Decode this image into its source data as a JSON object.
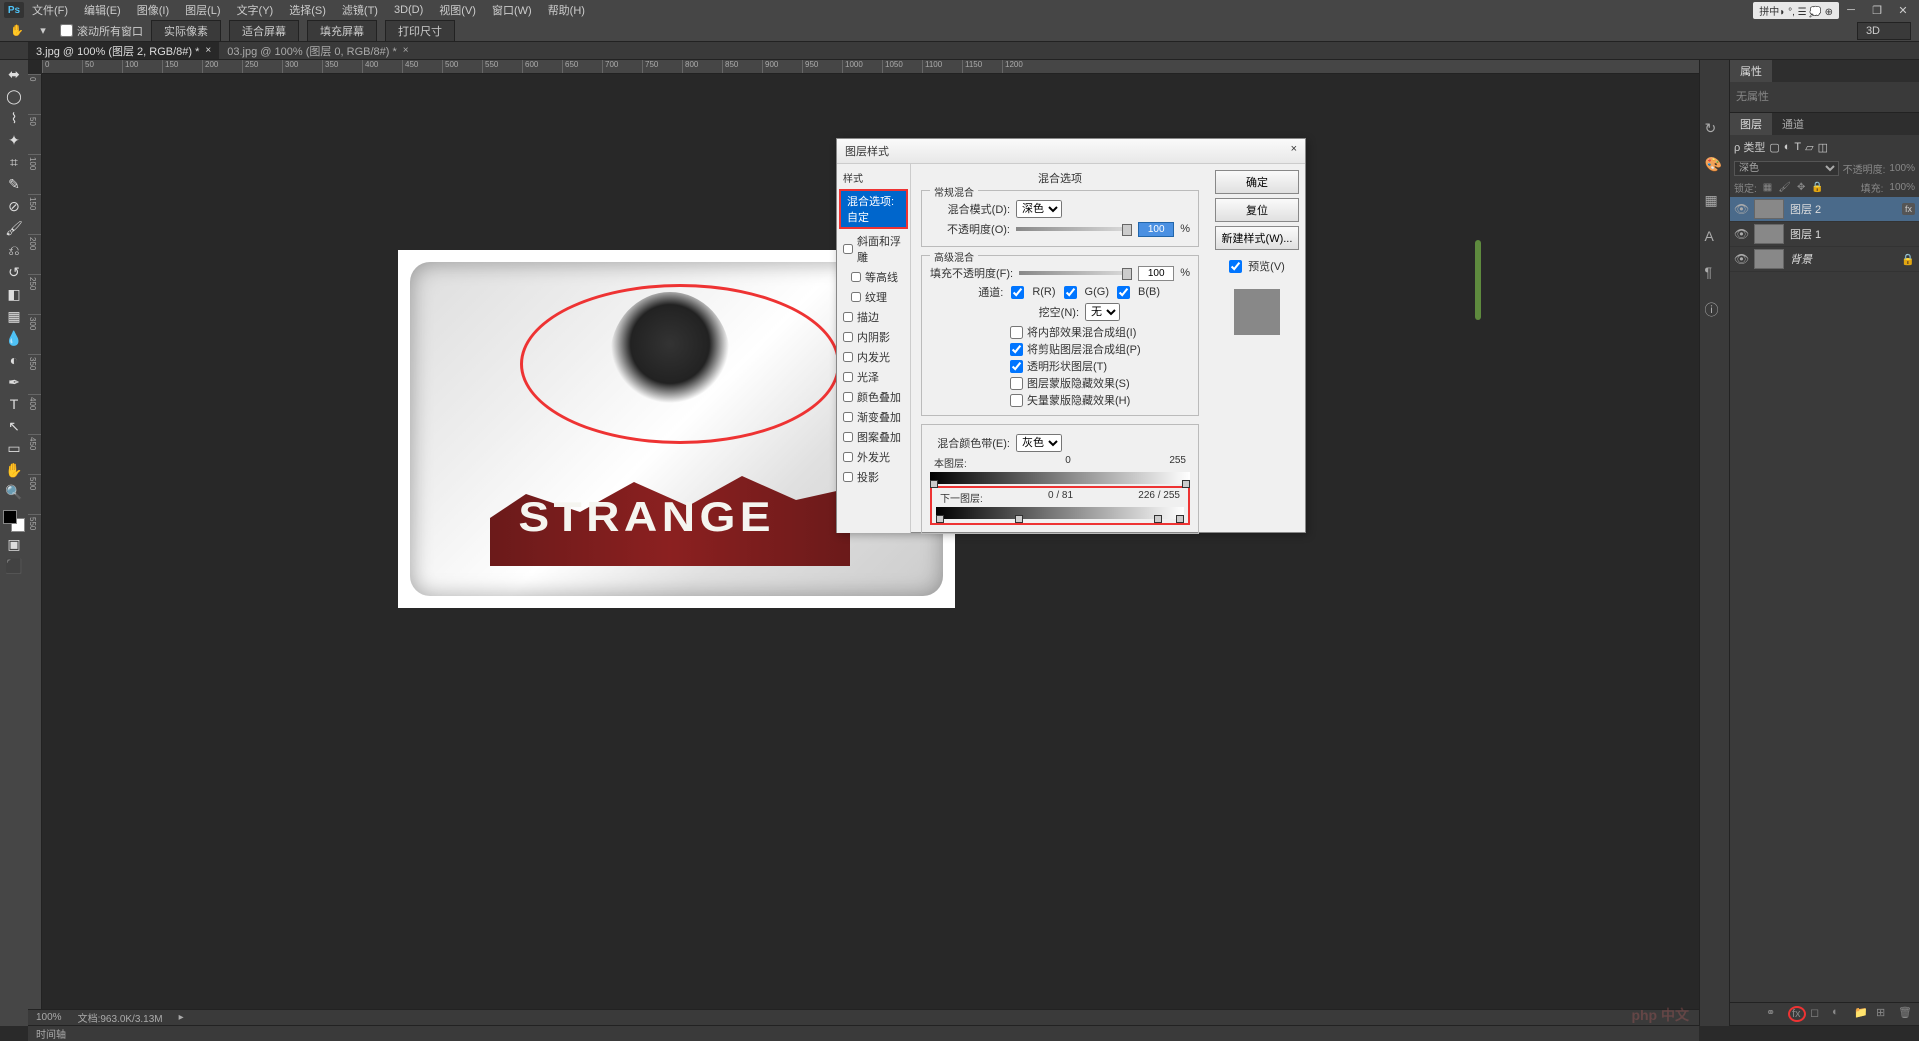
{
  "app": {
    "logo": "Ps"
  },
  "menu": {
    "items": [
      "文件(F)",
      "编辑(E)",
      "图像(I)",
      "图层(L)",
      "文字(Y)",
      "选择(S)",
      "滤镜(T)",
      "3D(D)",
      "视图(V)",
      "窗口(W)",
      "帮助(H)"
    ]
  },
  "status_tray": "拼中◗ °,  ☰ 💭 ⊕",
  "options": {
    "scroll_all": "滚动所有窗口",
    "buttons": [
      "实际像素",
      "适合屏幕",
      "填充屏幕",
      "打印尺寸"
    ],
    "mode3d": "3D"
  },
  "tabs": [
    {
      "label": "3.jpg @ 100% (图层 2, RGB/8#) *",
      "active": true
    },
    {
      "label": "03.jpg @ 100% (图层 0, RGB/8#) *",
      "active": false
    }
  ],
  "rulers": {
    "h": [
      "0",
      "50",
      "100",
      "150",
      "200",
      "250",
      "300",
      "350",
      "400",
      "450",
      "500",
      "550",
      "600",
      "650",
      "700",
      "750",
      "800",
      "850",
      "900",
      "950",
      "1000",
      "1050",
      "1100",
      "1150",
      "1200"
    ],
    "v": [
      "0",
      "50",
      "100",
      "150",
      "200",
      "250",
      "300",
      "350",
      "400",
      "450",
      "500",
      "550"
    ]
  },
  "artwork": {
    "text": "STRANGE"
  },
  "dialog": {
    "title": "图层样式",
    "close": "×",
    "styles_header": "样式",
    "blend_opts_custom": "混合选项:自定",
    "style_items": [
      {
        "label": "斜面和浮雕",
        "chk": false
      },
      {
        "label": "等高线",
        "chk": false,
        "indent": true
      },
      {
        "label": "纹理",
        "chk": false,
        "indent": true
      },
      {
        "label": "描边",
        "chk": false
      },
      {
        "label": "内阴影",
        "chk": false
      },
      {
        "label": "内发光",
        "chk": false
      },
      {
        "label": "光泽",
        "chk": false
      },
      {
        "label": "颜色叠加",
        "chk": false
      },
      {
        "label": "渐变叠加",
        "chk": false
      },
      {
        "label": "图案叠加",
        "chk": false
      },
      {
        "label": "外发光",
        "chk": false
      },
      {
        "label": "投影",
        "chk": false
      }
    ],
    "blending": {
      "section_title": "混合选项",
      "general": "常规混合",
      "mode_label": "混合模式(D):",
      "mode_value": "深色",
      "opacity_label": "不透明度(O):",
      "opacity_value": "100",
      "pct": "%",
      "advanced": "高级混合",
      "fill_label": "填充不透明度(F):",
      "fill_value": "100",
      "channels_label": "通道:",
      "ch_r": "R(R)",
      "ch_g": "G(G)",
      "ch_b": "B(B)",
      "knockout_label": "挖空(N):",
      "knockout_value": "无",
      "adv_checks": [
        "将内部效果混合成组(I)",
        "将剪贴图层混合成组(P)",
        "透明形状图层(T)",
        "图层蒙版隐藏效果(S)",
        "矢量蒙版隐藏效果(H)"
      ],
      "adv_states": [
        false,
        true,
        true,
        false,
        false
      ],
      "blendif_label": "混合颜色带(E):",
      "blendif_value": "灰色",
      "this_layer": "本图层:",
      "this_lo": "0",
      "this_hi": "255",
      "under_layer": "下一图层:",
      "under_lo": "0   /   81",
      "under_hi": "226   /   255"
    },
    "buttons": {
      "ok": "确定",
      "cancel": "复位",
      "newstyle": "新建样式(W)...",
      "preview": "预览(V)"
    }
  },
  "panels": {
    "properties": {
      "tab": "属性",
      "empty": "无属性"
    },
    "layers": {
      "tabs": [
        "图层",
        "通道"
      ],
      "kind_label": "ρ 类型",
      "blend_mode": "深色",
      "opacity_label": "不透明度:",
      "opacity_value": "100%",
      "lock_label": "锁定:",
      "fill_label": "填充:",
      "fill_value": "100%",
      "items": [
        {
          "name": "图层 2",
          "sel": true,
          "fx": true
        },
        {
          "name": "图层 1",
          "sel": false,
          "fx": false
        },
        {
          "name": "背景",
          "sel": false,
          "fx": false,
          "locked": true
        }
      ]
    }
  },
  "status": {
    "zoom": "100%",
    "doc": "文档:963.0K/3.13M"
  },
  "timeline": "时间轴",
  "watermark": "php 中文"
}
